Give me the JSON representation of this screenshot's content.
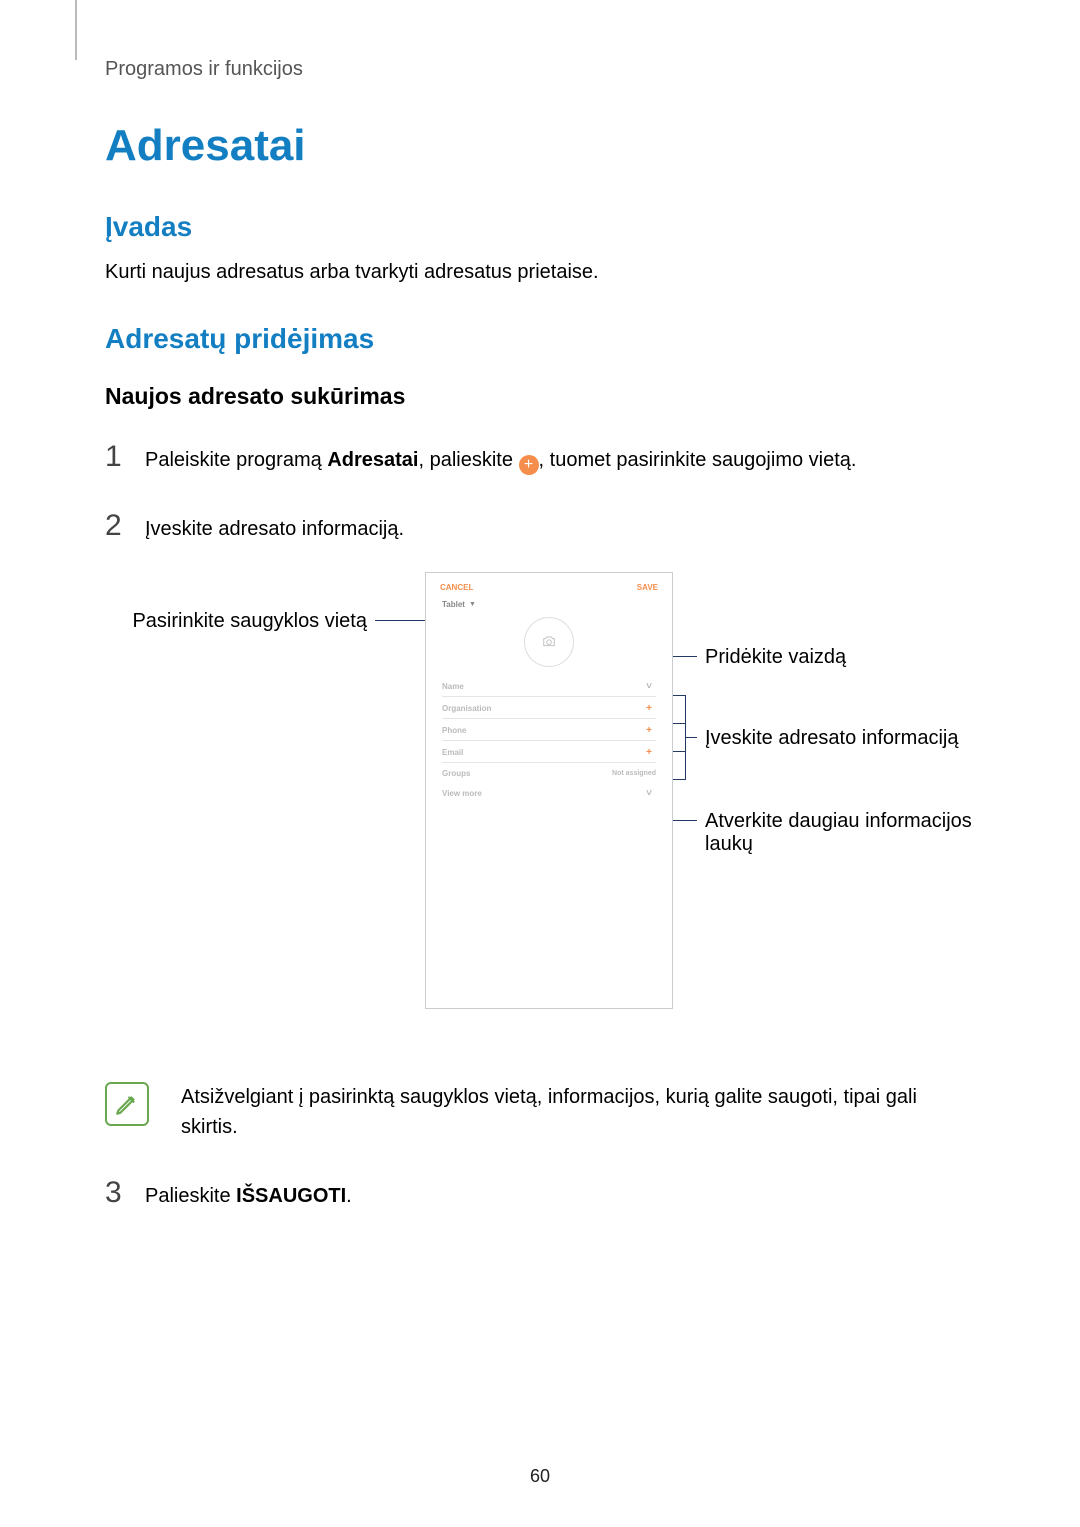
{
  "header": "Programos ir funkcijos",
  "pageNumber": "60",
  "h1": "Adresatai",
  "intro": {
    "heading": "Įvadas",
    "body": "Kurti naujus adresatus arba tvarkyti adresatus prietaise."
  },
  "section": {
    "heading": "Adresatų pridėjimas",
    "sub": "Naujos adresato sukūrimas",
    "step1": {
      "num": "1",
      "pre": "Paleiskite programą ",
      "bold": "Adresatai",
      "mid": ", palieskite ",
      "plus": "+",
      "post": ", tuomet pasirinkite saugojimo vietą."
    },
    "step2": {
      "num": "2",
      "text": "Įveskite adresato informaciją."
    },
    "note": "Atsižvelgiant į pasirinktą saugyklos vietą, informacijos, kurią galite saugoti, tipai gali skirtis.",
    "step3": {
      "num": "3",
      "pre": "Palieskite ",
      "bold": "IŠSAUGOTI",
      "post": "."
    }
  },
  "annotations": {
    "storage": "Pasirinkite saugyklos vietą",
    "addImage": "Pridėkite vaizdą",
    "enterInfo": "Įveskite adresato informaciją",
    "moreFields": "Atverkite daugiau informacijos laukų"
  },
  "mock": {
    "cancel": "CANCEL",
    "save": "SAVE",
    "storage": "Tablet",
    "cameraGlyph": "⌂",
    "rows": {
      "name": "Name",
      "organisation": "Organisation",
      "phone": "Phone",
      "email": "Email",
      "groups": "Groups",
      "groupsAct": "Not assigned",
      "viewmore": "View more"
    }
  }
}
